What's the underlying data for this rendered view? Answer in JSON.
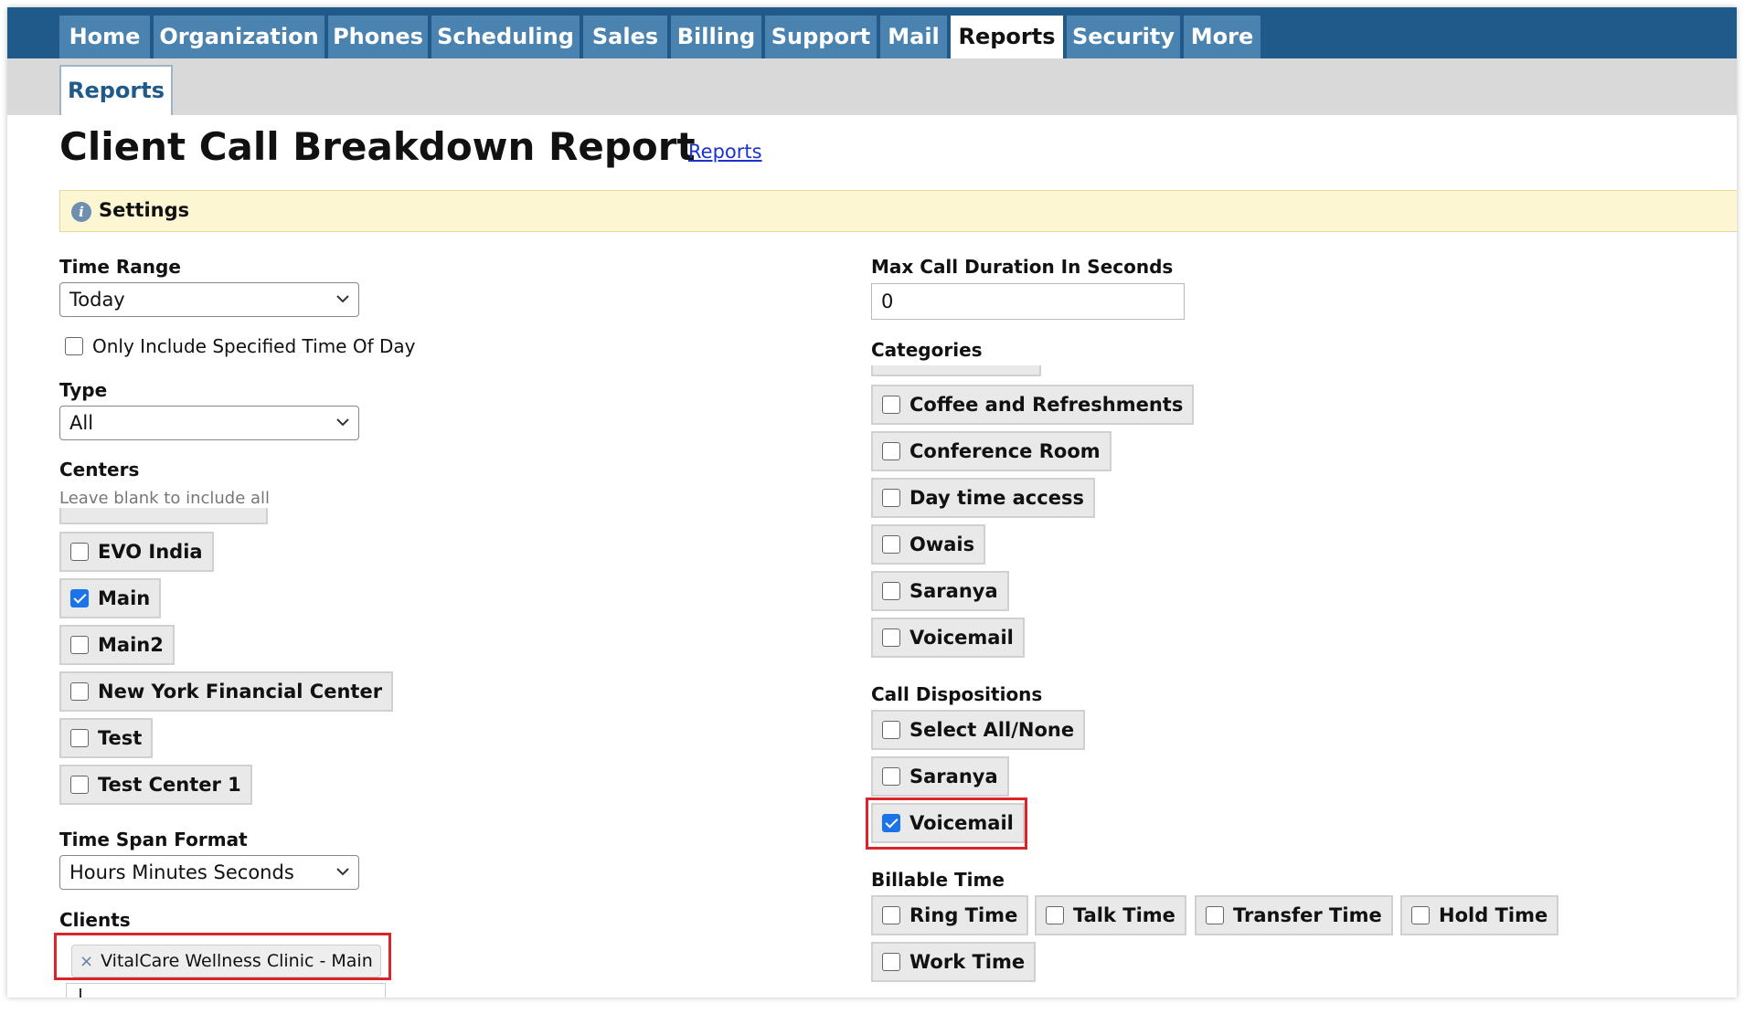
{
  "nav": {
    "tabs": [
      "Home",
      "Organization",
      "Phones",
      "Scheduling",
      "Sales",
      "Billing",
      "Support",
      "Mail",
      "Reports",
      "Security",
      "More"
    ],
    "active": "Reports",
    "subtab": "Reports"
  },
  "page": {
    "title": "Client Call Breakdown Report",
    "link": "Reports"
  },
  "settings": {
    "label": "Settings"
  },
  "left": {
    "time_range": {
      "label": "Time Range",
      "value": "Today"
    },
    "only_time_of_day": {
      "label": "Only Include Specified Time Of Day",
      "checked": false
    },
    "type": {
      "label": "Type",
      "value": "All"
    },
    "centers": {
      "label": "Centers",
      "hint": "Leave blank to include all",
      "items": [
        {
          "label": "EVO India",
          "checked": false
        },
        {
          "label": "Main",
          "checked": true
        },
        {
          "label": "Main2",
          "checked": false
        },
        {
          "label": "New York Financial Center",
          "checked": false
        },
        {
          "label": "Test",
          "checked": false
        },
        {
          "label": "Test Center 1",
          "checked": false
        }
      ]
    },
    "time_span_format": {
      "label": "Time Span Format",
      "value": "Hours Minutes Seconds"
    },
    "clients": {
      "label": "Clients",
      "selected": [
        "VitalCare Wellness Clinic - Main"
      ],
      "remove_glyph": "×"
    }
  },
  "right": {
    "max_call_duration": {
      "label": "Max Call Duration In Seconds",
      "value": "0"
    },
    "categories": {
      "label": "Categories",
      "items": [
        {
          "label": "Coffee and Refreshments",
          "checked": false
        },
        {
          "label": "Conference Room",
          "checked": false
        },
        {
          "label": "Day time access",
          "checked": false
        },
        {
          "label": "Owais",
          "checked": false
        },
        {
          "label": "Saranya",
          "checked": false
        },
        {
          "label": "Voicemail",
          "checked": false
        }
      ]
    },
    "call_dispositions": {
      "label": "Call Dispositions",
      "items": [
        {
          "label": "Select All/None",
          "checked": false
        },
        {
          "label": "Saranya",
          "checked": false
        },
        {
          "label": "Voicemail",
          "checked": true
        }
      ]
    },
    "billable_time": {
      "label": "Billable Time",
      "items": [
        {
          "label": "Ring Time",
          "checked": false
        },
        {
          "label": "Talk Time",
          "checked": false
        },
        {
          "label": "Transfer Time",
          "checked": false
        },
        {
          "label": "Hold Time",
          "checked": false
        },
        {
          "label": "Work Time",
          "checked": false
        }
      ]
    }
  },
  "colors": {
    "nav_bg": "#1f5a8a",
    "tab_bg": "#4b83b0",
    "settings_bg": "#fdf6d3",
    "highlight": "#d9252a",
    "checkbox_checked": "#1a73e8"
  }
}
